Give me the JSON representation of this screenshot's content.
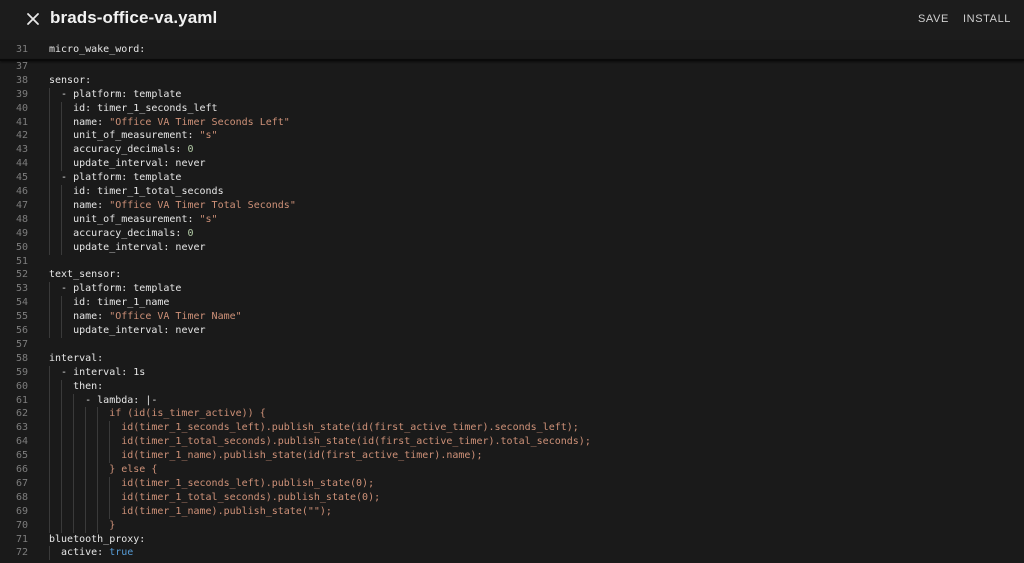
{
  "header": {
    "title": "brads-office-va.yaml",
    "save_label": "SAVE",
    "install_label": "INSTALL",
    "close_icon": "close-icon"
  },
  "editor": {
    "lines": [
      {
        "num": "31",
        "indent": 0,
        "parts": [
          {
            "t": "micro_wake_word:",
            "c": "k"
          }
        ]
      },
      {
        "num": "37",
        "indent": 0,
        "parts": []
      },
      {
        "num": "38",
        "indent": 0,
        "parts": [
          {
            "t": "sensor:",
            "c": "k"
          }
        ]
      },
      {
        "num": "39",
        "indent": 2,
        "parts": [
          {
            "t": "- platform: template",
            "c": "k"
          }
        ]
      },
      {
        "num": "40",
        "indent": 4,
        "parts": [
          {
            "t": "id: timer_1_seconds_left",
            "c": "k"
          }
        ]
      },
      {
        "num": "41",
        "indent": 4,
        "parts": [
          {
            "t": "name: ",
            "c": "k"
          },
          {
            "t": "\"Office VA Timer Seconds Left\"",
            "c": "s"
          }
        ]
      },
      {
        "num": "42",
        "indent": 4,
        "parts": [
          {
            "t": "unit_of_measurement: ",
            "c": "k"
          },
          {
            "t": "\"s\"",
            "c": "s"
          }
        ]
      },
      {
        "num": "43",
        "indent": 4,
        "parts": [
          {
            "t": "accuracy_decimals: ",
            "c": "k"
          },
          {
            "t": "0",
            "c": "n"
          }
        ]
      },
      {
        "num": "44",
        "indent": 4,
        "parts": [
          {
            "t": "update_interval: never",
            "c": "k"
          }
        ]
      },
      {
        "num": "45",
        "indent": 2,
        "parts": [
          {
            "t": "- platform: template",
            "c": "k"
          }
        ]
      },
      {
        "num": "46",
        "indent": 4,
        "parts": [
          {
            "t": "id: timer_1_total_seconds",
            "c": "k"
          }
        ]
      },
      {
        "num": "47",
        "indent": 4,
        "parts": [
          {
            "t": "name: ",
            "c": "k"
          },
          {
            "t": "\"Office VA Timer Total Seconds\"",
            "c": "s"
          }
        ]
      },
      {
        "num": "48",
        "indent": 4,
        "parts": [
          {
            "t": "unit_of_measurement: ",
            "c": "k"
          },
          {
            "t": "\"s\"",
            "c": "s"
          }
        ]
      },
      {
        "num": "49",
        "indent": 4,
        "parts": [
          {
            "t": "accuracy_decimals: ",
            "c": "k"
          },
          {
            "t": "0",
            "c": "n"
          }
        ]
      },
      {
        "num": "50",
        "indent": 4,
        "parts": [
          {
            "t": "update_interval: never",
            "c": "k"
          }
        ]
      },
      {
        "num": "51",
        "indent": 0,
        "parts": []
      },
      {
        "num": "52",
        "indent": 0,
        "parts": [
          {
            "t": "text_sensor:",
            "c": "k"
          }
        ]
      },
      {
        "num": "53",
        "indent": 2,
        "parts": [
          {
            "t": "- platform: template",
            "c": "k"
          }
        ]
      },
      {
        "num": "54",
        "indent": 4,
        "parts": [
          {
            "t": "id: timer_1_name",
            "c": "k"
          }
        ]
      },
      {
        "num": "55",
        "indent": 4,
        "parts": [
          {
            "t": "name: ",
            "c": "k"
          },
          {
            "t": "\"Office VA Timer Name\"",
            "c": "s"
          }
        ]
      },
      {
        "num": "56",
        "indent": 4,
        "parts": [
          {
            "t": "update_interval: never",
            "c": "k"
          }
        ]
      },
      {
        "num": "57",
        "indent": 0,
        "parts": []
      },
      {
        "num": "58",
        "indent": 0,
        "parts": [
          {
            "t": "interval:",
            "c": "k"
          }
        ]
      },
      {
        "num": "59",
        "indent": 2,
        "parts": [
          {
            "t": "- interval: 1s",
            "c": "k"
          }
        ]
      },
      {
        "num": "60",
        "indent": 4,
        "parts": [
          {
            "t": "then:",
            "c": "k"
          }
        ]
      },
      {
        "num": "61",
        "indent": 6,
        "parts": [
          {
            "t": "- lambda: |-",
            "c": "k"
          }
        ]
      },
      {
        "num": "62",
        "indent": 10,
        "parts": [
          {
            "t": "if (id(is_timer_active)) {",
            "c": "lam"
          }
        ]
      },
      {
        "num": "63",
        "indent": 12,
        "parts": [
          {
            "t": "id(timer_1_seconds_left).publish_state(id(first_active_timer).seconds_left);",
            "c": "lam"
          }
        ]
      },
      {
        "num": "64",
        "indent": 12,
        "parts": [
          {
            "t": "id(timer_1_total_seconds).publish_state(id(first_active_timer).total_seconds);",
            "c": "lam"
          }
        ]
      },
      {
        "num": "65",
        "indent": 12,
        "parts": [
          {
            "t": "id(timer_1_name).publish_state(id(first_active_timer).name);",
            "c": "lam"
          }
        ]
      },
      {
        "num": "66",
        "indent": 10,
        "parts": [
          {
            "t": "} else {",
            "c": "lam"
          }
        ]
      },
      {
        "num": "67",
        "indent": 12,
        "parts": [
          {
            "t": "id(timer_1_seconds_left).publish_state(0);",
            "c": "lam"
          }
        ]
      },
      {
        "num": "68",
        "indent": 12,
        "parts": [
          {
            "t": "id(timer_1_total_seconds).publish_state(0);",
            "c": "lam"
          }
        ]
      },
      {
        "num": "69",
        "indent": 12,
        "parts": [
          {
            "t": "id(timer_1_name).publish_state(\"\");",
            "c": "lam"
          }
        ]
      },
      {
        "num": "70",
        "indent": 10,
        "parts": [
          {
            "t": "}",
            "c": "lam"
          }
        ]
      },
      {
        "num": "71",
        "indent": 0,
        "parts": [
          {
            "t": "bluetooth_proxy:",
            "c": "k"
          }
        ]
      },
      {
        "num": "72",
        "indent": 2,
        "parts": [
          {
            "t": "active: ",
            "c": "k"
          },
          {
            "t": "true",
            "c": "b"
          }
        ]
      }
    ]
  },
  "colors": {
    "background": "#1c1c1c",
    "string": "#ce9178",
    "number": "#b5cea8",
    "boolean": "#569cd6",
    "line_number": "#7d7d7d"
  }
}
